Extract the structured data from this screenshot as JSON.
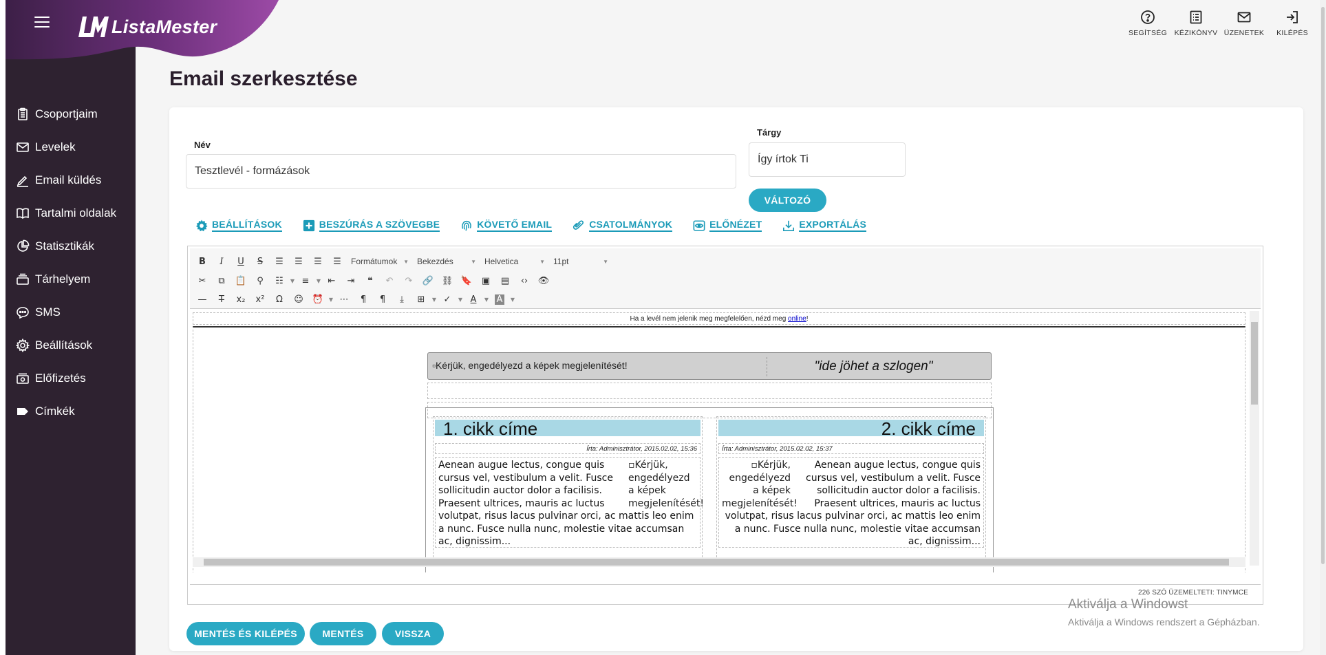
{
  "brand": {
    "name": "ListaMester",
    "accent": "#2aa9c4",
    "sidebar_bg": "#2e2230"
  },
  "sidebar": {
    "items": [
      {
        "label": "Csoportjaim",
        "icon": "clipboard-icon"
      },
      {
        "label": "Levelek",
        "icon": "envelope-icon"
      },
      {
        "label": "Email küldés",
        "icon": "pencil-icon"
      },
      {
        "label": "Tartalmi oldalak",
        "icon": "book-icon"
      },
      {
        "label": "Statisztikák",
        "icon": "pie-chart-icon"
      },
      {
        "label": "Tárhelyem",
        "icon": "storage-icon"
      },
      {
        "label": "SMS",
        "icon": "chat-icon"
      },
      {
        "label": "Beállítások",
        "icon": "gear-icon"
      },
      {
        "label": "Előfizetés",
        "icon": "cash-icon"
      },
      {
        "label": "Címkék",
        "icon": "tag-icon"
      }
    ]
  },
  "topnav": {
    "help": "SEGÍTSÉG",
    "manual": "KÉZIKÖNYV",
    "messages": "ÜZENETEK",
    "logout": "KILÉPÉS"
  },
  "page": {
    "title": "Email szerkesztése"
  },
  "form": {
    "name_label": "Név",
    "name_value": "Tesztlevél - formázások",
    "subject_label": "Tárgy",
    "subject_value": "Így írtok Ti",
    "variable_button": "VÁLTOZÓ"
  },
  "tabs": [
    {
      "label": "BEÁLLÍTÁSOK",
      "icon": "gear-icon"
    },
    {
      "label": "BESZÚRÁS A SZÖVEGBE",
      "icon": "plus-square-icon"
    },
    {
      "label": "KÖVETŐ EMAIL",
      "icon": "fingerprint-icon"
    },
    {
      "label": "CSATOLMÁNYOK",
      "icon": "paperclip-icon"
    },
    {
      "label": "ELŐNÉZET",
      "icon": "eye-icon"
    },
    {
      "label": "EXPORTÁLÁS",
      "icon": "download-icon"
    }
  ],
  "toolbar": {
    "formats": "Formátumok",
    "block": "Bekezdés",
    "font": "Helvetica",
    "size": "11pt"
  },
  "email": {
    "notice_text": "Ha a levél nem jelenik meg megfelelően, nézd meg ",
    "notice_link": "online",
    "notice_end": "!",
    "header_img_alt": "Kérjük, engedélyezd a képek megjelenítését!",
    "slogan": "\"ide jöhet a szlogen\"",
    "articles": [
      {
        "title": "1. cikk címe",
        "meta": "Írta: Adminisztrátor, 2015.02.02, 15:36",
        "body": "Aenean augue lectus, congue quis cursus vel, vestibulum a velit. Fusce sollicitudin auctor dolor a facilisis. Praesent ultrices, mauris ac luctus volutpat, risus lacus pulvinar orci, ac mattis leo enim a nunc. Fusce nulla nunc, molestie vitae accumsan ac, dignissim...",
        "img_alt": "Kérjük, engedélyezd a képek megjelenítését!"
      },
      {
        "title": "2. cikk címe",
        "meta": "Írta: Adminisztrátor, 2015.02.02, 15:37",
        "body": "Aenean augue lectus, congue quis cursus vel, vestibulum a velit. Fusce sollicitudin auctor dolor a facilisis. Praesent ultrices, mauris ac luctus volutpat, risus lacus pulvinar orci, ac mattis leo enim a nunc. Fusce nulla nunc, molestie vitae accumsan ac, dignissim...",
        "img_alt": "Kérjük, engedélyezd a képek megjelenítését!"
      }
    ]
  },
  "statusbar": {
    "text": "226 SZÓ ÜZEMELTETI: TINYMCE"
  },
  "actions": {
    "save_exit": "MENTÉS ÉS KILÉPÉS",
    "save": "MENTÉS",
    "back": "VISSZA"
  },
  "watermark": {
    "line1": "Aktiválja a Windowst",
    "line2": "Aktiválja a Windows rendszert a Gépházban."
  }
}
